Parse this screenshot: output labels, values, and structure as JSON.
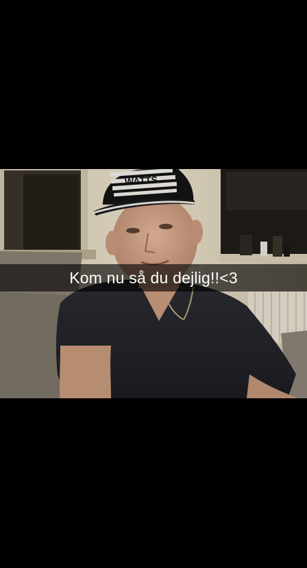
{
  "snap": {
    "caption": "Kom nu så du dejlig!!<3"
  },
  "photo": {
    "cap_logo_text": "WATTS"
  },
  "colors": {
    "background": "#000000",
    "caption_bar": "#000000",
    "caption_text": "#ffffff"
  }
}
